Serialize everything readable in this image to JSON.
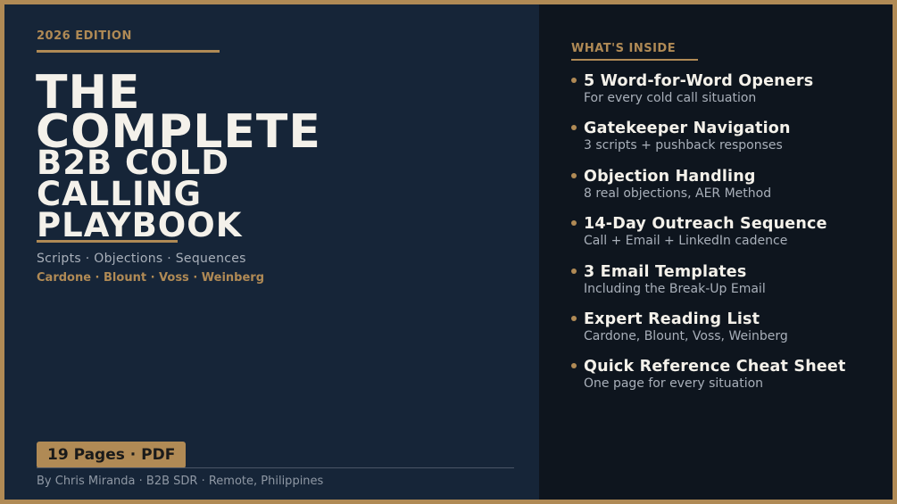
{
  "cover": {
    "edition": "2026 EDITION",
    "title_lines": [
      "THE",
      "COMPLETE",
      "B2B COLD",
      "CALLING",
      "PLAYBOOK"
    ],
    "subline": "Scripts  ·  Objections  ·  Sequences",
    "authors": "Cardone · Blount · Voss · Weinberg",
    "badge": "19 Pages  ·  PDF",
    "byline": "By Chris Miranda  ·  B2B SDR  ·  Remote, Philippines"
  },
  "inside": {
    "heading": "WHAT'S INSIDE",
    "items": [
      {
        "title": "5 Word-for-Word Openers",
        "sub": "For every cold call situation"
      },
      {
        "title": "Gatekeeper Navigation",
        "sub": "3 scripts + pushback responses"
      },
      {
        "title": "Objection Handling",
        "sub": "8 real objections, AER Method"
      },
      {
        "title": "14-Day Outreach Sequence",
        "sub": "Call + Email + LinkedIn cadence"
      },
      {
        "title": "3 Email Templates",
        "sub": "Including the Break-Up Email"
      },
      {
        "title": "Expert Reading List",
        "sub": "Cardone, Blount, Voss, Weinberg"
      },
      {
        "title": "Quick Reference Cheat Sheet",
        "sub": "One page for every situation"
      }
    ]
  },
  "colors": {
    "accent": "#b08a55",
    "left_panel": "#162538",
    "right_panel": "#0e151e",
    "title_text": "#f4f1ea"
  }
}
